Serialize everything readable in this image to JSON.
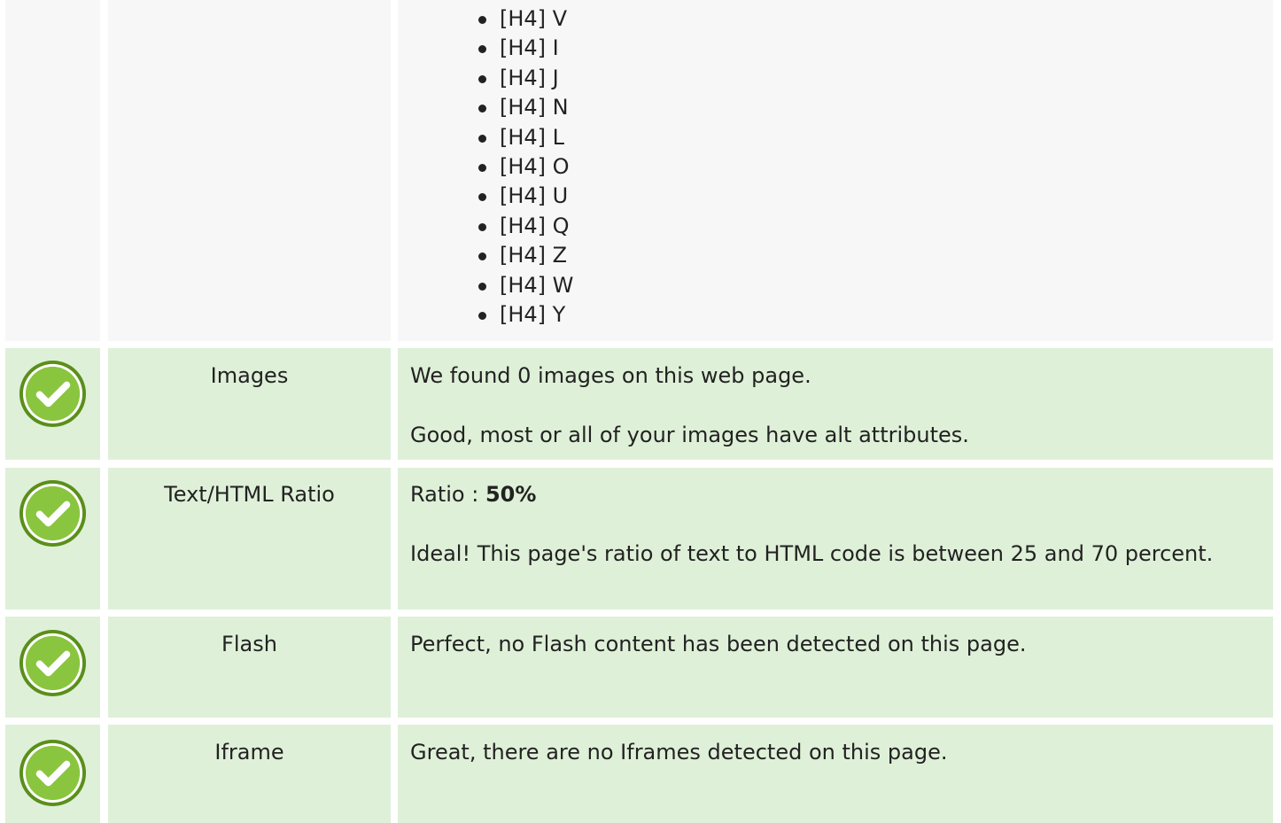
{
  "headings": {
    "items": [
      "[H4] V",
      "[H4] I",
      "[H4] J",
      "[H4] N",
      "[H4] L",
      "[H4] O",
      "[H4] U",
      "[H4] Q",
      "[H4] Z",
      "[H4] W",
      "[H4] Y"
    ]
  },
  "rows": [
    {
      "label": "Images",
      "line1": "We found 0 images on this web page.",
      "line2": "Good, most or all of your images have alt attributes.",
      "status_icon": "check-circle-icon"
    },
    {
      "label": "Text/HTML Ratio",
      "ratio_prefix": "Ratio : ",
      "ratio_value": "50%",
      "line2": "Ideal! This page's ratio of text to HTML code is between 25 and 70 percent.",
      "status_icon": "check-circle-icon"
    },
    {
      "label": "Flash",
      "line1": "Perfect, no Flash content has been detected on this page.",
      "status_icon": "check-circle-icon"
    },
    {
      "label": "Iframe",
      "line1": "Great, there are no Iframes detected on this page.",
      "status_icon": "check-circle-icon"
    }
  ],
  "colors": {
    "pass_row": "#dff0d8",
    "neutral_row": "#f7f7f7",
    "check_green": "#8ac53f"
  }
}
